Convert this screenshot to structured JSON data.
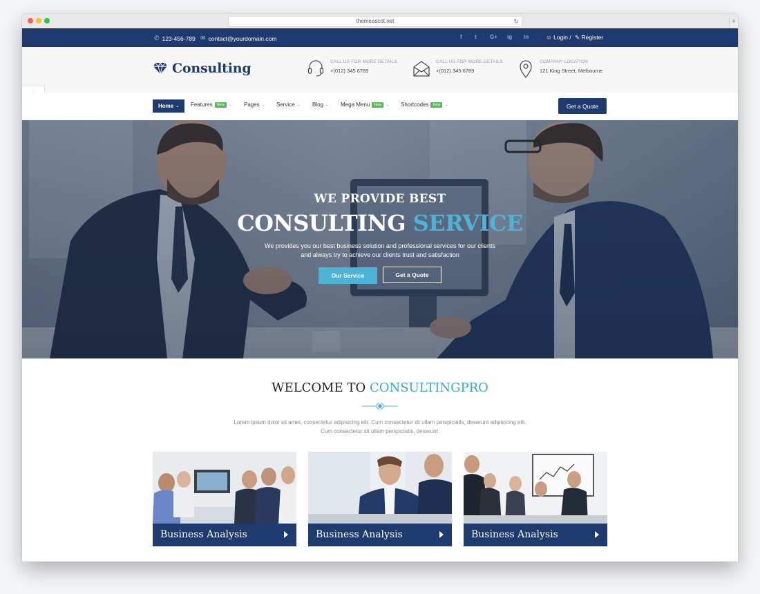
{
  "browser": {
    "url": "themeascot.net"
  },
  "topbar": {
    "phone": "123-456-789",
    "email": "contact@yourdomain.com",
    "social": [
      "f",
      "t",
      "G+",
      "ig",
      "in"
    ],
    "login": "Login /",
    "register": "Register"
  },
  "header": {
    "logo": "Consulting",
    "info": [
      {
        "label": "CALL US FOR MORE DETAILS",
        "value": "+(012) 345 6789",
        "icon": "headset-icon"
      },
      {
        "label": "CALL US FOR MORE DETAILS",
        "value": "+(012) 345 6789",
        "icon": "envelope-icon"
      },
      {
        "label": "COMPANY LOCATION",
        "value": "121 King Street, Melbourne",
        "icon": "map-pin-icon"
      }
    ]
  },
  "nav": {
    "items": [
      {
        "label": "Home"
      },
      {
        "label": "Features",
        "badge": "New"
      },
      {
        "label": "Pages"
      },
      {
        "label": "Service"
      },
      {
        "label": "Blog"
      },
      {
        "label": "Mega Menu",
        "badge": "New"
      },
      {
        "label": "Shortcodes",
        "badge": "New"
      }
    ],
    "cta": "Get a Quote"
  },
  "hero": {
    "subtitle": "WE PROVIDE BEST",
    "title_main": "CONSULTING",
    "title_accent": "SERVICE",
    "desc_line1": "We provides you our best business solution and professional services for our clients",
    "desc_line2": "and always try to achieve our clients trust and satisfaction",
    "btn_service": "Our Service",
    "btn_quote": "Get a Quote"
  },
  "welcome": {
    "title_main": "WELCOME TO",
    "title_accent": "CONSULTINGPRO",
    "desc_line1": "Lorem ipsum dolor sit amet, consectetur adipisicing elit. Cum consectetur sit ullam perspiciatis, deserunt adipisicing elit.",
    "desc_line2": "Cum consectetur sit ullam perspiciatis, deserunt."
  },
  "cards": [
    {
      "title": "Business Analysis"
    },
    {
      "title": "Business Analysis"
    },
    {
      "title": "Business Analysis"
    }
  ],
  "colors": {
    "primary": "#1e3a6e",
    "accent": "#4db3d6",
    "new_badge": "#5cb85c"
  }
}
